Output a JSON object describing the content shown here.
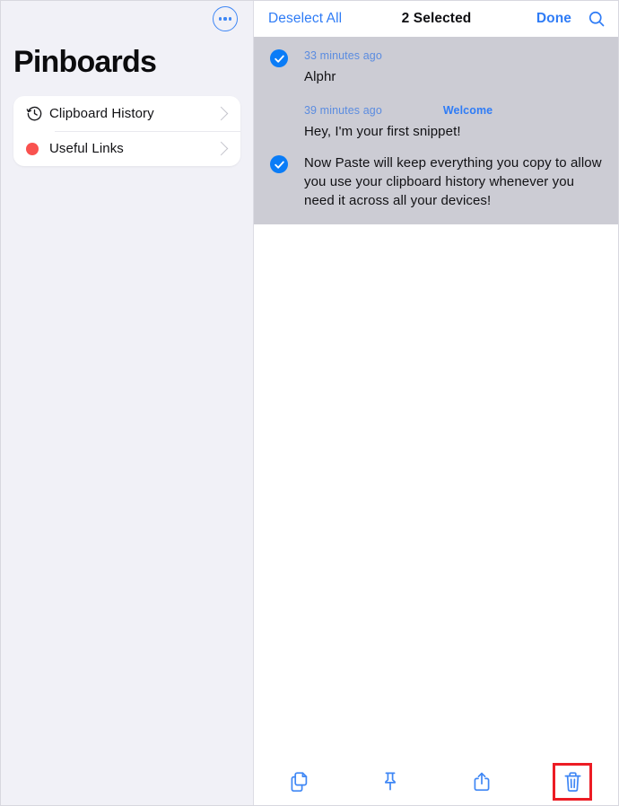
{
  "sidebar": {
    "more_button": "more-options",
    "title": "Pinboards",
    "items": [
      {
        "label": "Clipboard History",
        "icon": "clock-history-icon"
      },
      {
        "label": "Useful Links",
        "icon": "red-dot-icon"
      }
    ]
  },
  "content": {
    "nav": {
      "deselect_all": "Deselect All",
      "title": "2 Selected",
      "done": "Done",
      "search_icon": "search-icon"
    },
    "snippets": [
      {
        "selected": true,
        "time": "33 minutes ago",
        "tag": "",
        "text": "Alphr"
      },
      {
        "selected": false,
        "time": "39 minutes ago",
        "tag": "Welcome",
        "text": "Hey, I'm your first snippet!"
      },
      {
        "selected": true,
        "time": "",
        "tag": "",
        "text": "Now Paste will keep everything you copy to allow you use your clipboard history whenever you need it across all your devices!"
      }
    ],
    "toolbar": [
      {
        "name": "copy-button",
        "icon": "copy-documents-icon",
        "highlighted": false
      },
      {
        "name": "pin-button",
        "icon": "pin-icon",
        "highlighted": false
      },
      {
        "name": "share-button",
        "icon": "share-upload-icon",
        "highlighted": false
      },
      {
        "name": "delete-button",
        "icon": "trash-icon",
        "highlighted": true
      }
    ]
  },
  "colors": {
    "accent_blue": "#2f7cf6",
    "selection_gray": "#ccccd4",
    "sidebar_bg": "#f1f1f7",
    "red_dot": "#f9524f",
    "highlight_red": "#ec1c24"
  }
}
